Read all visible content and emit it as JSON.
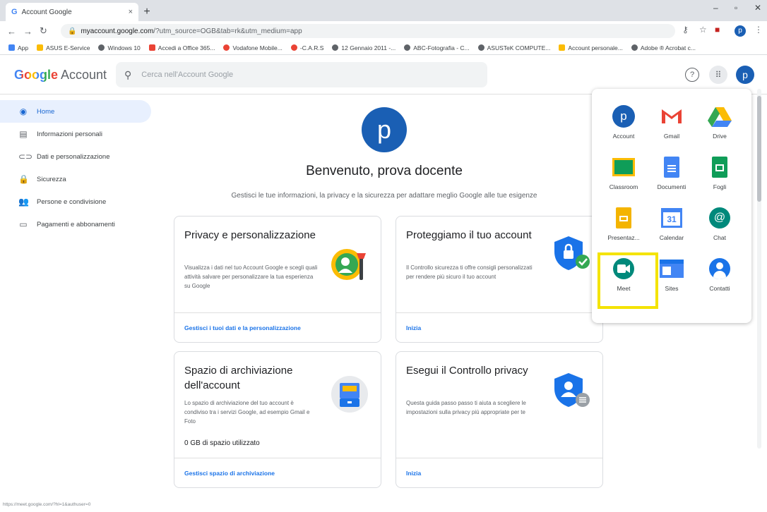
{
  "browser": {
    "tab_title": "Account Google",
    "tab_close": "×",
    "new_tab": "+",
    "url_host": "myaccount.google.com",
    "url_path": "/?utm_source=OGB&tab=rk&utm_medium=app",
    "status_url": "https://meet.google.com/?hl=1&authuser=0",
    "bookmarks": [
      {
        "label": "App",
        "color": "#4285f4"
      },
      {
        "label": "ASUS E-Service",
        "color": "#fbbc05"
      },
      {
        "label": "Windows 10",
        "color": "#5f6368"
      },
      {
        "label": "Accedi a Office 365...",
        "color": "#ea4335"
      },
      {
        "label": "Vodafone Mobile...",
        "color": "#ea4335"
      },
      {
        "label": "-C.A.R.S",
        "color": "#ea4335"
      },
      {
        "label": "12 Gennaio 2011 -...",
        "color": "#5f6368"
      },
      {
        "label": "ABC-Fotografia - C...",
        "color": "#5f6368"
      },
      {
        "label": "ASUSTeK COMPUTE...",
        "color": "#5f6368"
      },
      {
        "label": "Account personale...",
        "color": "#fbbc05"
      },
      {
        "label": "Adobe ® Acrobat c...",
        "color": "#5f6368"
      }
    ]
  },
  "header": {
    "logo_google": "Google",
    "logo_account": "Account",
    "search_placeholder": "Cerca nell'Account Google",
    "avatar_letter": "p"
  },
  "sidebar": {
    "items": [
      {
        "label": "Home",
        "active": true
      },
      {
        "label": "Informazioni personali"
      },
      {
        "label": "Dati e personalizzazione"
      },
      {
        "label": "Sicurezza"
      },
      {
        "label": "Persone e condivisione"
      },
      {
        "label": "Pagamenti e abbonamenti"
      }
    ]
  },
  "main": {
    "avatar_letter": "p",
    "welcome": "Benvenuto, prova docente",
    "subtitle": "Gestisci le tue informazioni, la privacy e la sicurezza per adattare meglio Google alle tue esigenze",
    "cards": [
      {
        "title": "Privacy e personalizzazione",
        "body": "Visualizza i dati nel tuo Account Google e scegli quali attività salvare per personalizzare la tua esperienza su Google",
        "link": "Gestisci i tuoi dati e la personalizzazione"
      },
      {
        "title": "Proteggiamo il tuo account",
        "body": "Il Controllo sicurezza ti offre consigli personalizzati per rendere più sicuro il tuo account",
        "link": "Inizia"
      },
      {
        "title": "Spazio di archiviazione dell'account",
        "body": "Lo spazio di archiviazione del tuo account è condiviso tra i servizi Google, ad esempio Gmail e Foto",
        "extra": "0 GB di spazio utilizzato",
        "link": "Gestisci spazio di archiviazione"
      },
      {
        "title": "Esegui il Controllo privacy",
        "body": "Questa guida passo passo ti aiuta a scegliere le impostazioni sulla privacy più appropriate per te",
        "link": "Inizia"
      }
    ]
  },
  "apps_menu": {
    "apps": [
      {
        "label": "Account"
      },
      {
        "label": "Gmail"
      },
      {
        "label": "Drive"
      },
      {
        "label": "Classroom"
      },
      {
        "label": "Documenti"
      },
      {
        "label": "Fogli"
      },
      {
        "label": "Presentaz..."
      },
      {
        "label": "Calendar",
        "icon_text": "31"
      },
      {
        "label": "Chat"
      },
      {
        "label": "Meet",
        "highlighted": true
      },
      {
        "label": "Sites"
      },
      {
        "label": "Contatti"
      }
    ],
    "highlight_color": "#f4e300"
  }
}
